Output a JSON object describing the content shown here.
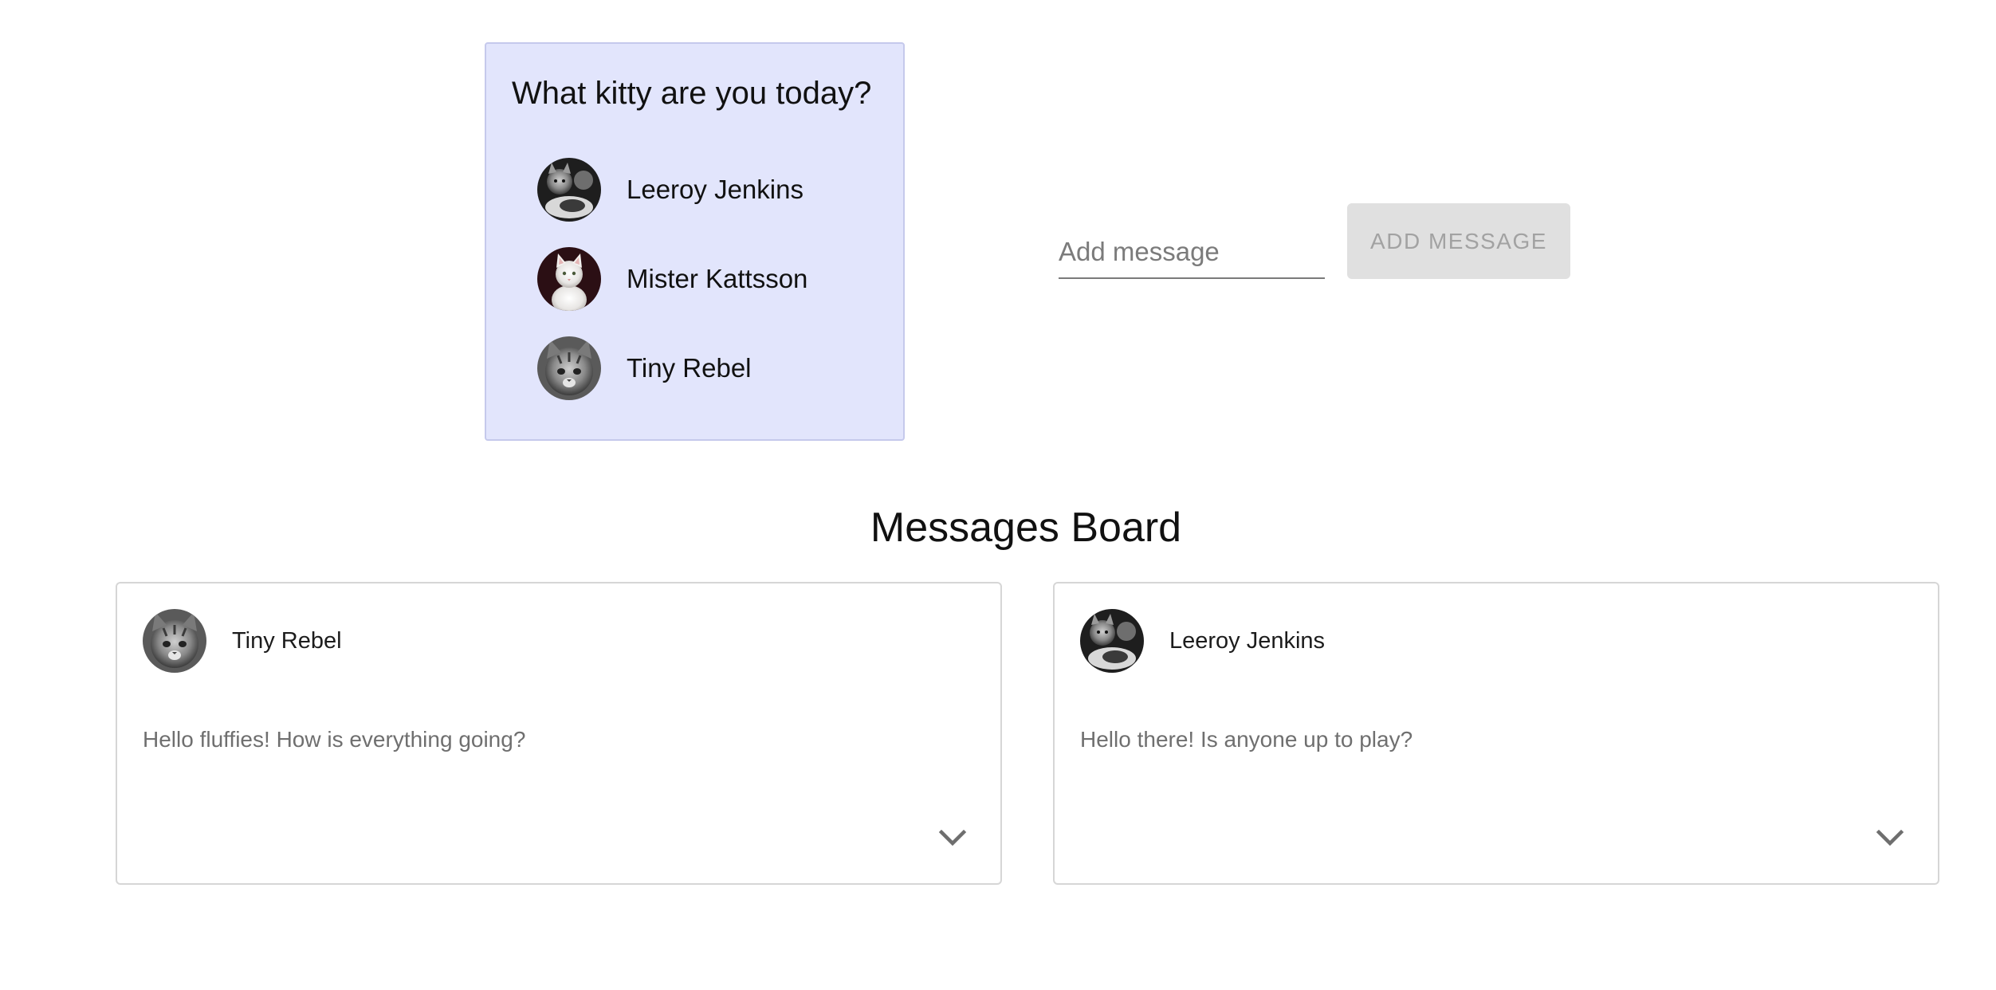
{
  "kitty_picker": {
    "title": "What kitty are you today?",
    "options": [
      {
        "name": "Leeroy Jenkins",
        "avatar_icon": "cat-photo-icon"
      },
      {
        "name": "Mister Kattsson",
        "avatar_icon": "cat-photo-icon"
      },
      {
        "name": "Tiny Rebel",
        "avatar_icon": "cat-photo-icon"
      }
    ]
  },
  "composer": {
    "placeholder": "Add message",
    "value": "",
    "button_label": "ADD MESSAGE",
    "button_state": "disabled"
  },
  "board": {
    "title": "Messages Board",
    "messages": [
      {
        "author": "Tiny Rebel",
        "text": "Hello fluffies! How is everything going?",
        "expand_icon": "chevron-down-icon"
      },
      {
        "author": "Leeroy Jenkins",
        "text": "Hello there! Is anyone up to play?",
        "expand_icon": "chevron-down-icon"
      }
    ]
  },
  "colors": {
    "panel_background": "#e2e5fc",
    "button_background": "#e0e0e0",
    "button_text": "#a2a2a2",
    "message_text": "#6f6f6f"
  }
}
